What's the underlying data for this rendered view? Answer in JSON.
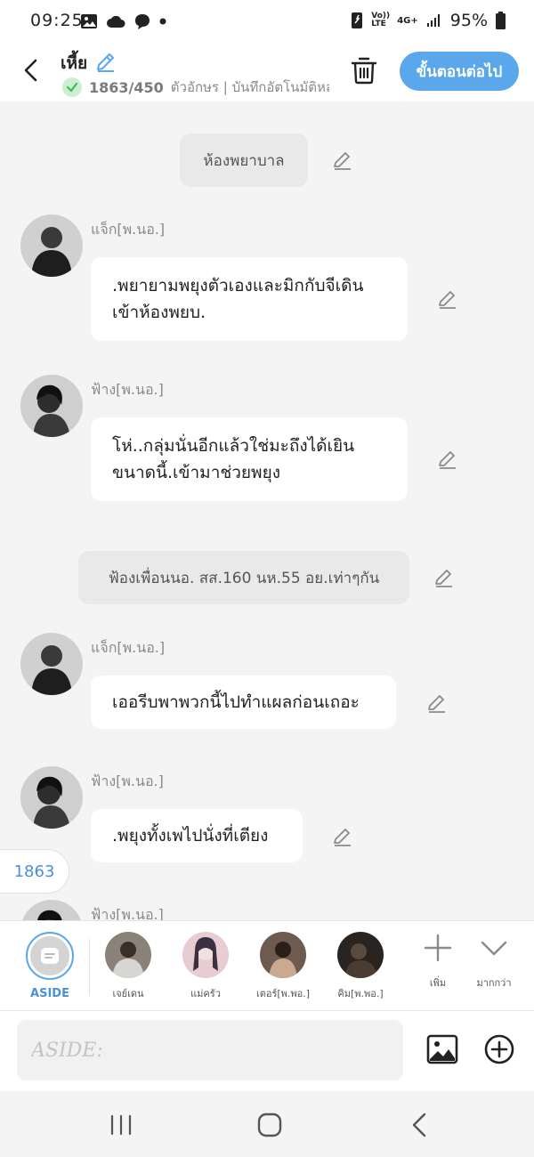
{
  "status_bar": {
    "time": "09:25",
    "battery": "95%",
    "left_icons": [
      "gallery-icon",
      "cloud-icon",
      "chat-icon",
      "dot-icon"
    ],
    "right_icons": [
      "nfc-icon",
      "volte-icon",
      "4g-icon",
      "signal-icon",
      "battery-icon"
    ],
    "volte": "Vo)) LTE",
    "network": "4G+"
  },
  "header": {
    "title": "เหี้ย",
    "char_count": "1863/450",
    "char_count_rest": "ตัวอักษร | บันทึกอัตโนมัติหล",
    "next_button": "ขั้นตอนต่อไป"
  },
  "chat": {
    "scene_1": "ห้องพยาบาล",
    "scene_2": "ฟ้องเพื่อนนอ. สส.160 นห.55 อย.เท่าๆกัน",
    "messages": [
      {
        "name": "แจ็ก[พ.นอ.]",
        "text": ".พยายามพยุงตัวเองและมิกกับจีเดินเข้าห้องพยบ."
      },
      {
        "name": "ฟ้าง[พ.นอ.]",
        "text": "โห่..กลุ่มนั่นอีกแล้วใช่มะถึงได้เยินขนาดนี้.เข้ามาช่วยพยุง"
      },
      {
        "name": "แจ็ก[พ.นอ.]",
        "text": "เออรีบพาพวกนี้ไปทำแผลก่อนเถอะ"
      },
      {
        "name": "ฟ้าง[พ.นอ.]",
        "text": ".พยุงทั้งเพไปนั่งที่เตียง"
      },
      {
        "name": "ฟ้าง[พ.นอ.]",
        "text": ""
      }
    ],
    "counter": "1863"
  },
  "characters": {
    "aside_label": "ASIDE",
    "items": [
      "เจย์เดน",
      "แม่ครัว",
      "เตอร์[พ.พอ.]",
      "คิม[พ.พอ.]"
    ],
    "add_label": "เพิ่ม",
    "more_label": "มากกว่า"
  },
  "input": {
    "placeholder": "ASIDE:"
  },
  "colors": {
    "accent": "#5aa7ec",
    "counter_text": "#4a90d9",
    "check_bg": "#cdeed1",
    "check_mark": "#3bbf5a"
  }
}
